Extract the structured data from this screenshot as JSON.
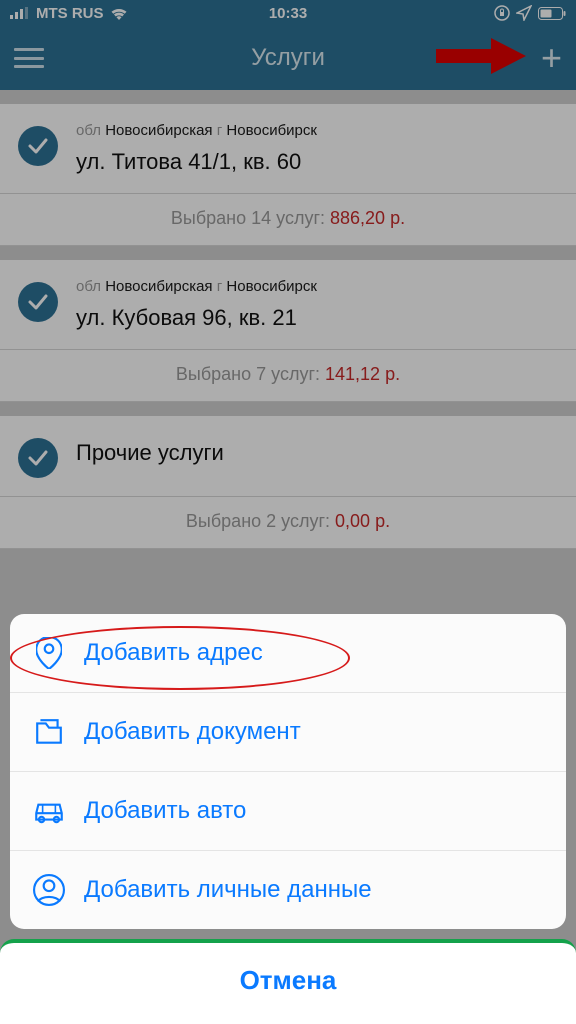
{
  "status": {
    "carrier": "MTS RUS",
    "time": "10:33"
  },
  "nav": {
    "title": "Услуги"
  },
  "addresses": [
    {
      "region_prefix": "обл",
      "region": "Новосибирская",
      "city_prefix": "г",
      "city": "Новосибирск",
      "address": "ул. Титова 41/1, кв. 60",
      "summary_label": "Выбрано 14 услуг: ",
      "summary_amount": "886,20 р."
    },
    {
      "region_prefix": "обл",
      "region": "Новосибирская",
      "city_prefix": "г",
      "city": "Новосибирск",
      "address": "ул. Кубовая 96, кв. 21",
      "summary_label": "Выбрано 7 услуг: ",
      "summary_amount": "141,12 р."
    }
  ],
  "other": {
    "title": "Прочие услуги",
    "summary_label": "Выбрано 2 услуг: ",
    "summary_amount": "0,00 р."
  },
  "sheet": {
    "add_address": "Добавить адрес",
    "add_document": "Добавить документ",
    "add_auto": "Добавить авто",
    "add_personal": "Добавить личные данные",
    "cancel": "Отмена"
  }
}
